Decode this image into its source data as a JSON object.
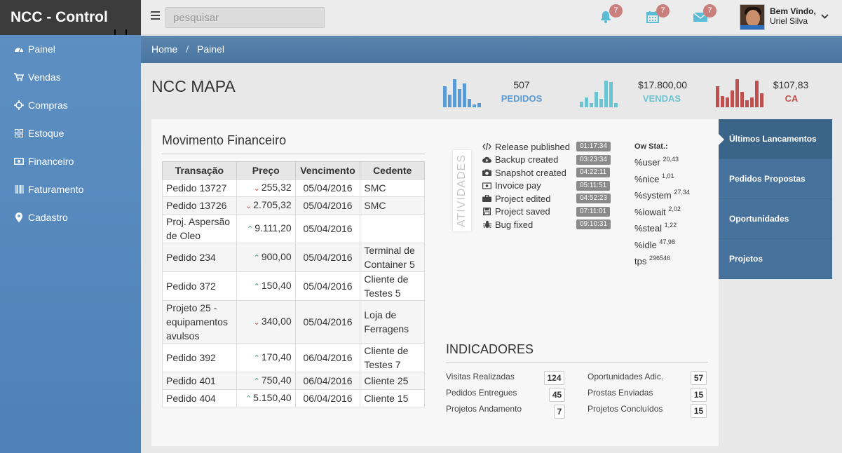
{
  "brand": "NCC - Control",
  "search": {
    "placeholder": "pesquisar"
  },
  "notifications": {
    "bell_count": "7",
    "calendar_count": "7",
    "mail_count": "7"
  },
  "user": {
    "welcome": "Bem Vindo,",
    "name": "Uriel Silva"
  },
  "sidebar": {
    "items": [
      {
        "label": "Painel",
        "icon": "dashboard-icon"
      },
      {
        "label": "Vendas",
        "icon": "cart-icon"
      },
      {
        "label": "Compras",
        "icon": "crosshair-icon"
      },
      {
        "label": "Estoque",
        "icon": "grid-icon"
      },
      {
        "label": "Financeiro",
        "icon": "money-icon"
      },
      {
        "label": "Faturamento",
        "icon": "barcode-icon"
      },
      {
        "label": "Cadastro",
        "icon": "map-marker-icon"
      }
    ]
  },
  "breadcrumb": {
    "home": "Home",
    "separator": "/",
    "current": "Painel"
  },
  "page": {
    "title": "NCC MAPA"
  },
  "stats": [
    {
      "value": "507",
      "label": "PEDIDOS",
      "color": "#5b9bd5"
    },
    {
      "value": "$17.800,00",
      "label": "VENDAS",
      "color": "#6cc3d1"
    },
    {
      "value": "$107,83",
      "label": "CA",
      "color": "#c0504d"
    }
  ],
  "movimento": {
    "title": "Movimento Financeiro",
    "headers": [
      "Transação",
      "Preço",
      "Vencimento",
      "Cedente"
    ],
    "rows": [
      {
        "transacao": "Pedido 13727",
        "dir": "down",
        "preco": "255,32",
        "venc": "05/04/2016",
        "cedente": "SMC"
      },
      {
        "transacao": "Pedido 13726",
        "dir": "down",
        "preco": "2.705,32",
        "venc": "05/04/2016",
        "cedente": "SMC"
      },
      {
        "transacao": "Proj. Aspersão de Oleo",
        "dir": "up",
        "preco": "9.111,20",
        "venc": "05/04/2016",
        "cedente": ""
      },
      {
        "transacao": "Pedido 234",
        "dir": "up",
        "preco": "900,00",
        "venc": "05/04/2016",
        "cedente": "Terminal de Container 5"
      },
      {
        "transacao": "Pedido 372",
        "dir": "up",
        "preco": "150,40",
        "venc": "05/04/2016",
        "cedente": "Cliente de Testes 5"
      },
      {
        "transacao": "Projeto 25 - equipamentos avulsos",
        "dir": "down",
        "preco": "340,00",
        "venc": "05/04/2016",
        "cedente": "Loja de Ferragens"
      },
      {
        "transacao": "Pedido 392",
        "dir": "up",
        "preco": "170,40",
        "venc": "06/04/2016",
        "cedente": "Cliente de Testes 7"
      },
      {
        "transacao": "Pedido 401",
        "dir": "up",
        "preco": "750,40",
        "venc": "06/04/2016",
        "cedente": "Cliente 25"
      },
      {
        "transacao": "Pedido 404",
        "dir": "up",
        "preco": "5.150,40",
        "venc": "06/04/2016",
        "cedente": "Cliente 15"
      }
    ]
  },
  "atividades": {
    "label": "ATIVIDADES",
    "items": [
      {
        "label": "Release published",
        "time": "01:17:34",
        "icon": "code-icon"
      },
      {
        "label": "Backup created",
        "time": "03:23:34",
        "icon": "cloud-upload-icon"
      },
      {
        "label": "Snapshot created",
        "time": "04:22:11",
        "icon": "camera-icon"
      },
      {
        "label": "Invoice pay",
        "time": "05:11:51",
        "icon": "money-icon"
      },
      {
        "label": "Project edited",
        "time": "04:52:23",
        "icon": "briefcase-icon"
      },
      {
        "label": "Project saved",
        "time": "07:11:01",
        "icon": "save-icon"
      },
      {
        "label": "Bug fixed",
        "time": "09:10:31",
        "icon": "bug-icon"
      }
    ]
  },
  "owstat": {
    "title": "Ow Stat.:",
    "items": [
      {
        "label": "%user",
        "value": "20,43"
      },
      {
        "label": "%nice",
        "value": "1,01"
      },
      {
        "label": "%system",
        "value": "27,34"
      },
      {
        "label": "%iowait",
        "value": "2,02"
      },
      {
        "label": "%steal",
        "value": "1,22"
      },
      {
        "label": "%idle",
        "value": "47,98"
      },
      {
        "label": "tps",
        "value": "296546"
      }
    ]
  },
  "indicadores": {
    "title": "INDICADORES",
    "left": [
      {
        "label": "Visitas Realizadas",
        "value": "124"
      },
      {
        "label": "Pedidos Entregues",
        "value": "45"
      },
      {
        "label": "Projetos Andamento",
        "value": "7"
      }
    ],
    "right": [
      {
        "label": "Oportunidades Adic.",
        "value": "57"
      },
      {
        "label": "Prostas Enviadas",
        "value": "15"
      },
      {
        "label": "Projetos Concluídos",
        "value": "15"
      }
    ]
  },
  "tabs": [
    {
      "label": "Últimos Lancamentos"
    },
    {
      "label": "Pedidos Propostas"
    },
    {
      "label": "Oportunidades"
    },
    {
      "label": "Projetos"
    }
  ]
}
